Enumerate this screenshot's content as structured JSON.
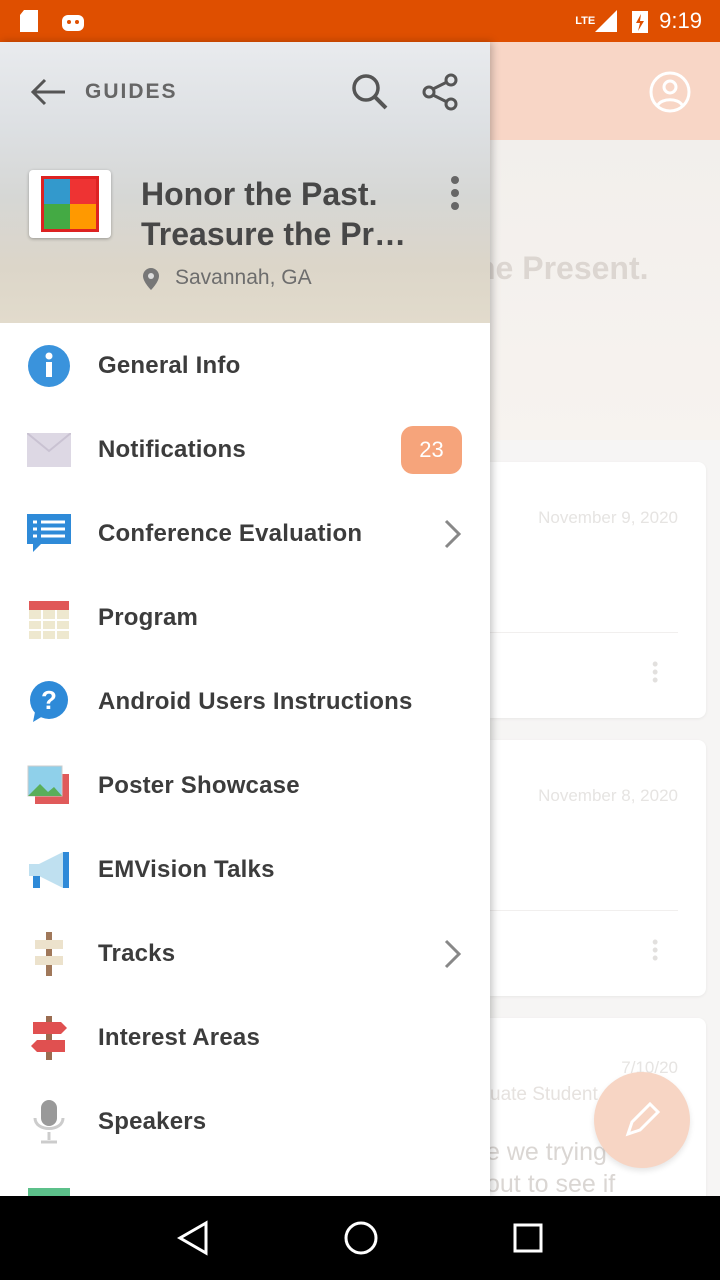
{
  "status_bar": {
    "time": "9:19",
    "network": "LTE"
  },
  "background": {
    "hero_title_fragment": "he Present.",
    "cards": [
      {
        "date": "November 9, 2020"
      },
      {
        "date": "November 8, 2020"
      },
      {
        "date": "7/10/20",
        "subtitle_fragment": "uate Student",
        "body_fragments": [
          "e we trying",
          "out to see if"
        ]
      }
    ]
  },
  "drawer": {
    "header": {
      "section_label": "GUIDES",
      "title_line1": "Honor the Past.",
      "title_line2": "Treasure the Present.",
      "location": "Savannah, GA"
    },
    "items": [
      {
        "label": "General Info",
        "icon": "info-icon"
      },
      {
        "label": "Notifications",
        "icon": "envelope-icon",
        "badge": "23"
      },
      {
        "label": "Conference Evaluation",
        "icon": "checklist-chat-icon",
        "chevron": true
      },
      {
        "label": "Program",
        "icon": "calendar-icon"
      },
      {
        "label": "Android Users Instructions",
        "icon": "question-bubble-icon"
      },
      {
        "label": "Poster Showcase",
        "icon": "picture-icon"
      },
      {
        "label": "EMVision Talks",
        "icon": "megaphone-icon"
      },
      {
        "label": "Tracks",
        "icon": "signpost-icon",
        "chevron": true
      },
      {
        "label": "Interest Areas",
        "icon": "signs-icon"
      },
      {
        "label": "Speakers",
        "icon": "microphone-icon"
      }
    ]
  },
  "colors": {
    "status_bar": "#df4f00",
    "accent": "#f6a47b",
    "app_bar": "#f8d6c6"
  }
}
